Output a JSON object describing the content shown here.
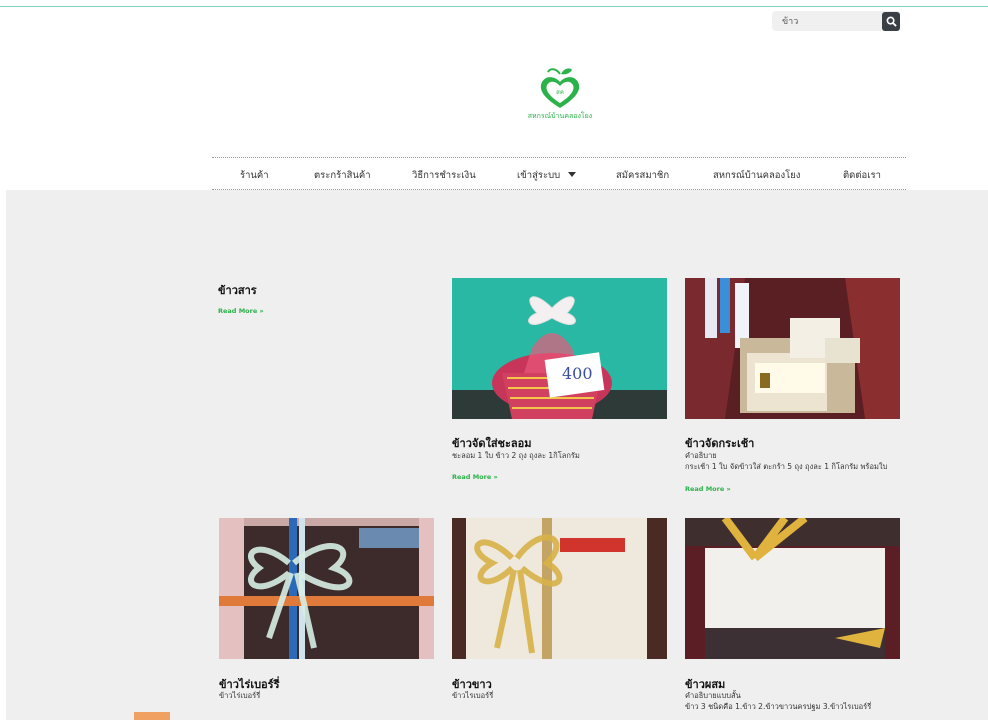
{
  "search": {
    "value": "ข้าว"
  },
  "logo": {
    "brand_text": "สหกรณ์บ้านคลองโยง",
    "badge_text": "สค"
  },
  "nav": {
    "items": [
      {
        "label": "ร้านค้า"
      },
      {
        "label": "ตระกร้าสินค้า"
      },
      {
        "label": "วิธีการชำระเงิน"
      },
      {
        "label": "เข้าสู่ระบบ"
      },
      {
        "label": "สมัครสมาชิก"
      },
      {
        "label": "สหกรณ์บ้านคลองโยง"
      },
      {
        "label": "ติดต่อเรา"
      }
    ]
  },
  "products": [
    {
      "title": "ข้าวสาร",
      "read_more": "Read More »"
    },
    {
      "title": "ข้าวจัดใส่ชะลอม",
      "desc1": "ชะลอม 1 ใบ ข้าว 2 ถุง ถุงละ 1กิโลกรัม",
      "read_more": "Read More »",
      "tag": "400"
    },
    {
      "title": "ข้าวจัดกระเช้า",
      "desc1": "คำอธิบาย",
      "desc2": "กระเช้า 1 ใบ จัดข้าวใส่ ตะกร้า 5 ถุง ถุงละ 1 กิโลกรัม พร้อมใบ",
      "read_more": "Read More »"
    },
    {
      "title": "ข้าวไร่เบอร์รี่",
      "desc1": "ข้าวไร่เบอร์รี่"
    },
    {
      "title": "ข้าวขาว",
      "desc1": "ข้าวไรเบอร์รี่"
    },
    {
      "title": "ข้าวผสม",
      "desc1": "คำอธิบายแบบสั้น",
      "desc2": "ข้าว 3 ชนิดคือ 1.ข้าว 2.ข้าวขาวนครปฐม 3.ข้าวไรเบอร์รี่"
    }
  ],
  "colors": {
    "accent": "#2cb24a",
    "teal_rule": "#7fcfc6",
    "page_bg": "#efefef"
  }
}
